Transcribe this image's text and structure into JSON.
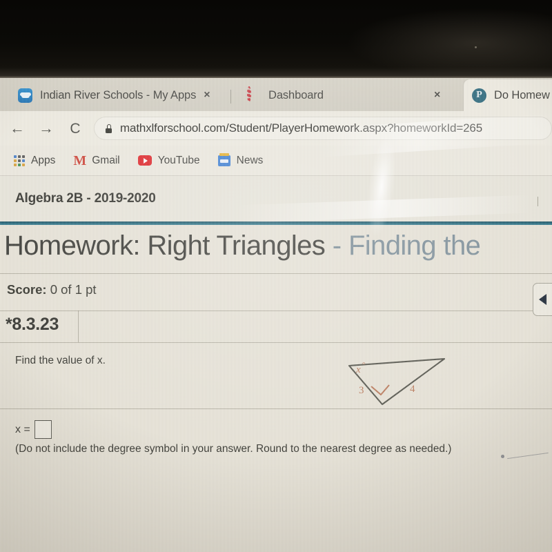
{
  "browser": {
    "tabs": [
      {
        "title": "Indian River Schools - My Apps",
        "favicon": "cloud-icon",
        "active": false,
        "close_label": "×"
      },
      {
        "title": "Dashboard",
        "favicon": "canvas-ring-icon",
        "active": false,
        "close_label": "×"
      },
      {
        "title": "Do Homew",
        "favicon": "pearson-p-icon",
        "active": true,
        "close_label": ""
      }
    ],
    "toolbar": {
      "back_icon": "←",
      "forward_icon": "→",
      "reload_icon": "⟳",
      "lock_icon": "lock-icon",
      "url": "mathxlforschool.com/Student/PlayerHomework.aspx?homeworkId=265"
    },
    "bookmarks": [
      {
        "label": "Apps",
        "icon": "apps-grid-icon"
      },
      {
        "label": "Gmail",
        "icon": "gmail-icon"
      },
      {
        "label": "YouTube",
        "icon": "youtube-icon"
      },
      {
        "label": "News",
        "icon": "google-news-icon"
      }
    ]
  },
  "page": {
    "course_name": "Algebra 2B - 2019-2020",
    "homework_title_main": "Homework: Right Triangles",
    "homework_title_dash": " - ",
    "homework_title_tail": "Finding the",
    "score_label": "Score:",
    "score_value": "0 of 1 pt",
    "question_number": "*8.3.23",
    "prompt": "Find the value of x.",
    "answer_prefix": "x =",
    "answer_value": "",
    "note": "(Do not include the degree symbol in your answer. Round to the nearest degree as needed.)",
    "next_button_icon": "previous-arrow-icon"
  },
  "figure": {
    "description": "right triangle",
    "angle_label": "x",
    "degree_symbol": "°",
    "side_left": "3",
    "side_right": "4",
    "right_angle_marker": "square-marker",
    "stroke_color": "#55554c",
    "label_color": "#bb7a5b"
  },
  "colors": {
    "accent_rule": "#256a7e",
    "screen_background": "#e8e4d8",
    "bezel": "#0b0a07",
    "text": "#35352f"
  }
}
